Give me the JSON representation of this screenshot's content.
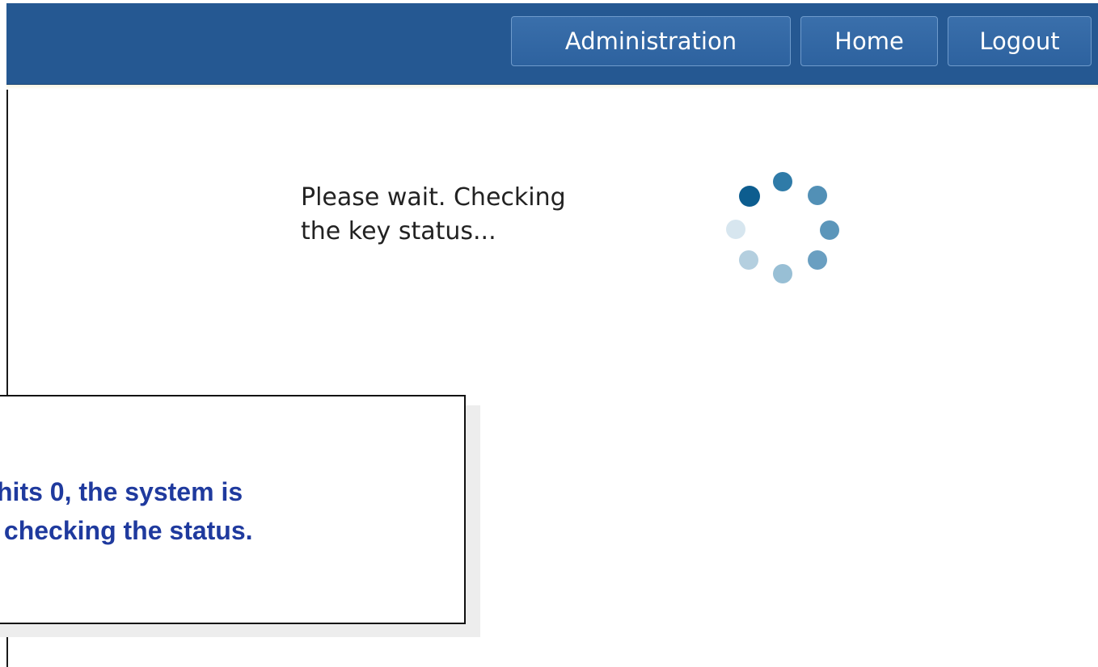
{
  "header": {
    "nav": [
      {
        "label": "Administration"
      },
      {
        "label": "Home"
      },
      {
        "label": "Logout"
      }
    ]
  },
  "status": {
    "message_line1": "Please wait. Checking",
    "message_line2": "the key status..."
  },
  "callout": {
    "line1": "hits 0, the system is",
    "line2": " checking the status."
  },
  "colors": {
    "header_bg": "#255892",
    "button_border": "#6f9bcc",
    "callout_text": "#1f3a9e",
    "spinner_dark": "#0d5d8f",
    "spinner_light": "#d7e6ef"
  },
  "icons": {
    "spinner": "loading-spinner-icon"
  }
}
